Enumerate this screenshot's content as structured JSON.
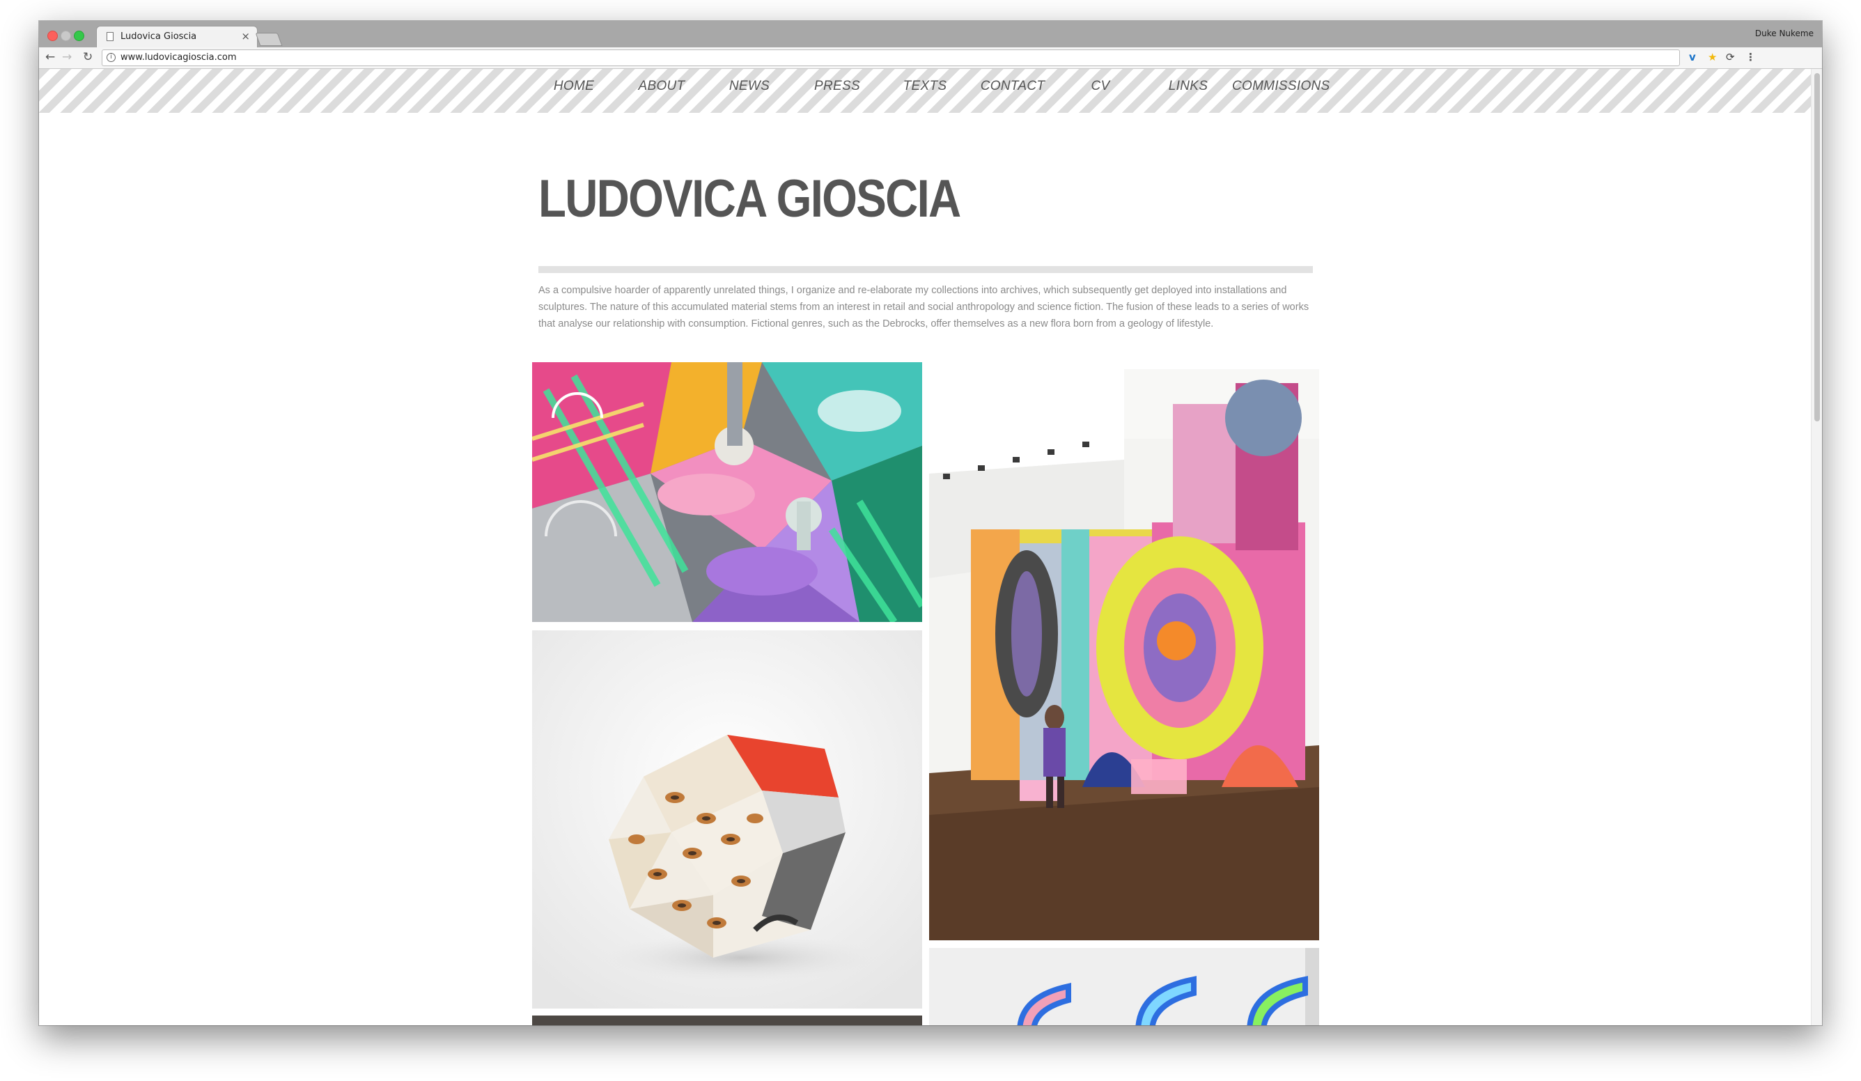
{
  "browser": {
    "tab_title": "Ludovica Gioscia",
    "tab_close": "×",
    "profile_name": "Duke Nukeme",
    "url": "www.ludovicagioscia.com",
    "nav_back": "←",
    "nav_forward": "→",
    "nav_reload": "↻",
    "ext_icons": [
      "vimeo-icon",
      "star-icon",
      "sync-icon",
      "menu-icon"
    ]
  },
  "site": {
    "nav": [
      "HOME",
      "ABOUT",
      "NEWS",
      "PRESS",
      "TEXTS",
      "CONTACT",
      "CV",
      "LINKS",
      "COMMISSIONS"
    ],
    "title": "LUDOVICA GIOSCIA",
    "intro": "As a compulsive hoarder of apparently unrelated things, I organize and re-elaborate my collections into archives, which subsequently get deployed into installations and sculptures. The nature of this accumulated material stems from an interest in retail and social anthropology and science fiction. The fusion of these leads to a series of works that analyse our relationship with consumption. Fictional genres, such as the Debrocks, offer themselves as a new flora born from a geology of lifestyle."
  },
  "gallery": [
    {
      "name": "colorful-collage-artwork",
      "kind": "collage"
    },
    {
      "name": "gallery-installation-wallpaper",
      "kind": "installation"
    },
    {
      "name": "crumpled-burnt-sculpture",
      "kind": "sculpture"
    },
    {
      "name": "dark-artwork-partial",
      "kind": "partial"
    },
    {
      "name": "neon-arches-artwork-partial",
      "kind": "partial"
    }
  ],
  "colors": {
    "nav_bg": "#dadada",
    "nav_text": "#555555",
    "title": "#555555",
    "body_text": "#8a8a8a",
    "stripe": "#dcdcdc"
  }
}
